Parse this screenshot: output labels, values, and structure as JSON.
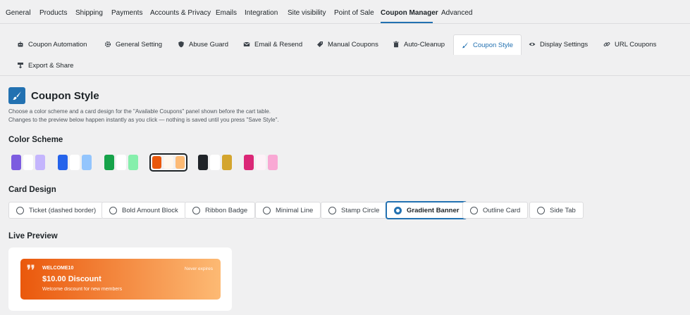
{
  "top_nav": {
    "tabs": [
      "General",
      "Products",
      "Shipping",
      "Payments",
      "Accounts & Privacy",
      "Emails",
      "Integration",
      "Site visibility",
      "Point of Sale",
      "Coupon Manager",
      "Advanced"
    ],
    "active": "Coupon Manager"
  },
  "sub_tabs": {
    "items": [
      {
        "label": "Coupon Automation",
        "icon": "robot-icon"
      },
      {
        "label": "General Setting",
        "icon": "gear-icon"
      },
      {
        "label": "Abuse Guard",
        "icon": "shield-icon"
      },
      {
        "label": "Email & Resend",
        "icon": "envelope-icon"
      },
      {
        "label": "Manual Coupons",
        "icon": "tag-icon"
      },
      {
        "label": "Auto-Cleanup",
        "icon": "trash-icon"
      },
      {
        "label": "Coupon Style",
        "icon": "brush-icon"
      },
      {
        "label": "Display Settings",
        "icon": "eye-icon"
      },
      {
        "label": "URL Coupons",
        "icon": "link-icon"
      },
      {
        "label": "Export & Share",
        "icon": "export-icon"
      }
    ],
    "active": "Coupon Style"
  },
  "page": {
    "title": "Coupon Style",
    "title_icon": "brush-icon",
    "description_1": "Choose a color scheme and a card design for the \"Available Coupons\" panel shown before the cart table.",
    "description_2": "Changes to the preview below happen instantly as you click — nothing is saved until you press \"Save Style\"."
  },
  "color_scheme": {
    "heading": "Color Scheme",
    "schemes": [
      {
        "colors": [
          "#7c5ce0",
          "#ffffff",
          "#c4b5fd"
        ]
      },
      {
        "colors": [
          "#2563eb",
          "#ffffff",
          "#93c5fd"
        ]
      },
      {
        "colors": [
          "#16a34a",
          "#ffffff",
          "#86efac"
        ]
      },
      {
        "colors": [
          "#ea580c",
          "#fff7ed",
          "#fdba74"
        ]
      },
      {
        "colors": [
          "#1f2328",
          "#ffffff",
          "#d4a52e"
        ]
      },
      {
        "colors": [
          "#db2777",
          "#fdf2f8",
          "#f9a8d4"
        ]
      }
    ],
    "selected_index": 3
  },
  "card_design": {
    "heading": "Card Design",
    "options": [
      "Ticket (dashed border)",
      "Bold Amount Block",
      "Ribbon Badge",
      "Minimal Line",
      "Stamp Circle",
      "Gradient Banner",
      "Outline Card",
      "Side Tab"
    ],
    "selected": "Gradient Banner"
  },
  "live_preview": {
    "heading": "Live Preview",
    "coupon": {
      "code": "WELCOME10",
      "expiry": "Never expires",
      "amount": "$10.00 Discount",
      "description": "Welcome discount for new members"
    }
  },
  "colors": {
    "accent": "#2271b1",
    "gradient_start": "#ea580c",
    "gradient_end": "#fdba74"
  }
}
